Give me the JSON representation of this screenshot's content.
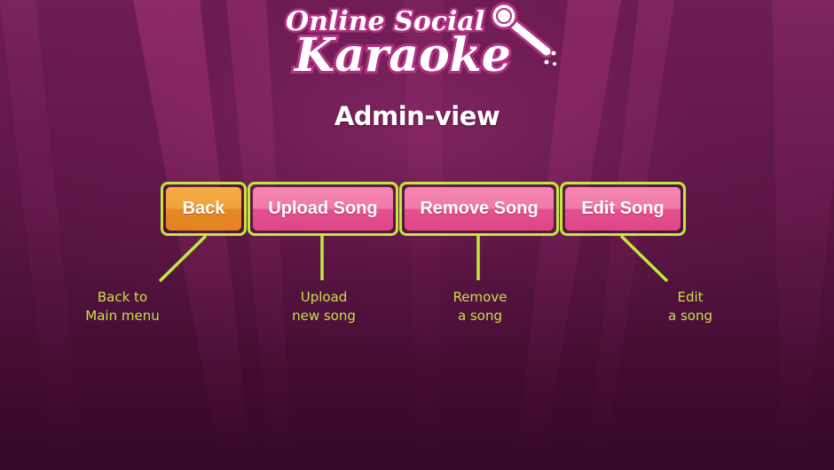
{
  "logo": {
    "line1": "Online Social",
    "line2": "Karaoke",
    "icon": "microphone-icon"
  },
  "page_title": "Admin-view",
  "buttons": [
    {
      "id": "back",
      "label": "Back",
      "color": "#e8902c",
      "caption": [
        "Back to",
        "Main menu"
      ]
    },
    {
      "id": "upload",
      "label": "Upload Song",
      "color": "#ec6ca2",
      "caption": [
        "Upload",
        "new song"
      ]
    },
    {
      "id": "remove",
      "label": "Remove Song",
      "color": "#ec6ca2",
      "caption": [
        "Remove",
        "a song"
      ]
    },
    {
      "id": "edit",
      "label": "Edit Song",
      "color": "#ec6ca2",
      "caption": [
        "Edit",
        "a song"
      ]
    }
  ],
  "colors": {
    "accent": "#c2e83c",
    "caption_text": "#c6e04a",
    "background": "#5a1645"
  }
}
